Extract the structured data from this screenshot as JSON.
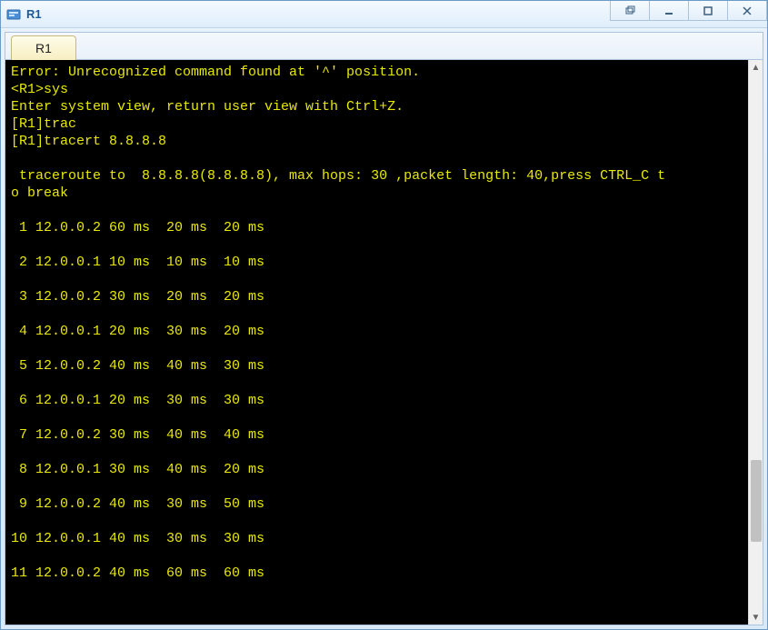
{
  "window": {
    "title": "R1"
  },
  "tabs": [
    {
      "label": "R1"
    }
  ],
  "terminal": {
    "full_text": "Error: Unrecognized command found at '^' position.\n<R1>sys\nEnter system view, return user view with Ctrl+Z.\n[R1]trac\n[R1]tracert 8.8.8.8\n\n traceroute to  8.8.8.8(8.8.8.8), max hops: 30 ,packet length: 40,press CTRL_C t\no break\n\n 1 12.0.0.2 60 ms  20 ms  20 ms\n\n 2 12.0.0.1 10 ms  10 ms  10 ms\n\n 3 12.0.0.2 30 ms  20 ms  20 ms\n\n 4 12.0.0.1 20 ms  30 ms  20 ms\n\n 5 12.0.0.2 40 ms  40 ms  30 ms\n\n 6 12.0.0.1 20 ms  30 ms  30 ms\n\n 7 12.0.0.2 30 ms  40 ms  40 ms\n\n 8 12.0.0.1 30 ms  40 ms  20 ms\n\n 9 12.0.0.2 40 ms  30 ms  50 ms\n\n10 12.0.0.1 40 ms  30 ms  30 ms\n\n11 12.0.0.2 40 ms  60 ms  60 ms",
    "header_lines": [
      "Error: Unrecognized command found at '^' position.",
      "<R1>sys",
      "Enter system view, return user view with Ctrl+Z.",
      "[R1]trac",
      "[R1]tracert 8.8.8.8",
      "",
      " traceroute to  8.8.8.8(8.8.8.8), max hops: 30 ,packet length: 40,press CTRL_C t",
      "o break",
      ""
    ],
    "tracert": {
      "target_ip": "8.8.8.8",
      "resolved": "8.8.8.8",
      "max_hops": 30,
      "packet_length": 40,
      "break_hint": "press CTRL_C to break",
      "hops": [
        {
          "n": 1,
          "ip": "12.0.0.2",
          "times_ms": [
            60,
            20,
            20
          ]
        },
        {
          "n": 2,
          "ip": "12.0.0.1",
          "times_ms": [
            10,
            10,
            10
          ]
        },
        {
          "n": 3,
          "ip": "12.0.0.2",
          "times_ms": [
            30,
            20,
            20
          ]
        },
        {
          "n": 4,
          "ip": "12.0.0.1",
          "times_ms": [
            20,
            30,
            20
          ]
        },
        {
          "n": 5,
          "ip": "12.0.0.2",
          "times_ms": [
            40,
            40,
            30
          ]
        },
        {
          "n": 6,
          "ip": "12.0.0.1",
          "times_ms": [
            20,
            30,
            30
          ]
        },
        {
          "n": 7,
          "ip": "12.0.0.2",
          "times_ms": [
            30,
            40,
            40
          ]
        },
        {
          "n": 8,
          "ip": "12.0.0.1",
          "times_ms": [
            30,
            40,
            20
          ]
        },
        {
          "n": 9,
          "ip": "12.0.0.2",
          "times_ms": [
            40,
            30,
            50
          ]
        },
        {
          "n": 10,
          "ip": "12.0.0.1",
          "times_ms": [
            40,
            30,
            30
          ]
        },
        {
          "n": 11,
          "ip": "12.0.0.2",
          "times_ms": [
            40,
            60,
            60
          ]
        }
      ]
    }
  }
}
